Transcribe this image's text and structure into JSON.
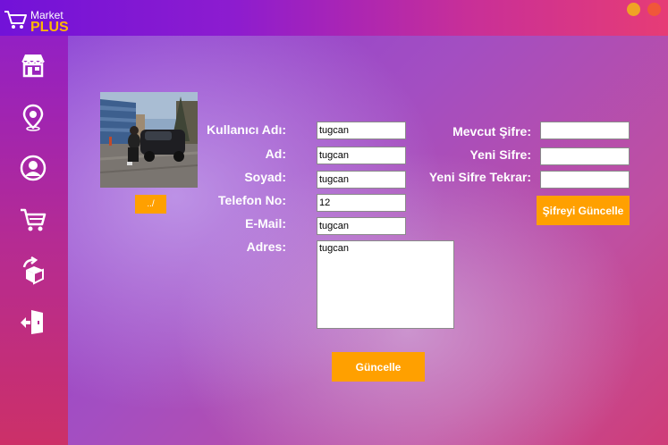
{
  "app": {
    "logo_top": "Market",
    "logo_bottom": "PLUS",
    "accent": "#ffa000"
  },
  "sidebar": {
    "items": [
      {
        "icon": "store-icon"
      },
      {
        "icon": "location-pin-icon"
      },
      {
        "icon": "user-icon"
      },
      {
        "icon": "cart-icon"
      },
      {
        "icon": "return-box-icon"
      },
      {
        "icon": "logout-icon"
      }
    ]
  },
  "profile": {
    "browse_label": "../"
  },
  "form": {
    "username_label": "Kullanıcı Adı:",
    "username_value": "tugcan",
    "name_label": "Ad:",
    "name_value": "tugcan",
    "surname_label": "Soyad:",
    "surname_value": "tugcan",
    "phone_label": "Telefon No:",
    "phone_value": "12",
    "email_label": "E-Mail:",
    "email_value": "tugcan",
    "address_label": "Adres:",
    "address_value": "tugcan",
    "update_label": "Güncelle"
  },
  "password": {
    "current_label": "Mevcut Şifre:",
    "current_value": "",
    "new_label": "Yeni Sifre:",
    "new_value": "",
    "repeat_label": "Yeni Sifre Tekrar:",
    "repeat_value": "",
    "update_label": "Şifreyi Güncelle"
  }
}
